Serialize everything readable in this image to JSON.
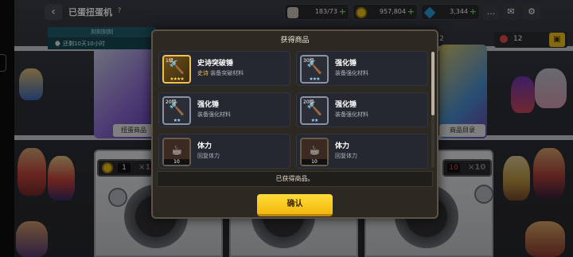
{
  "header": {
    "title": "已蛋扭蛋机",
    "back_glyph": "‹",
    "help_glyph": "?"
  },
  "event": {
    "tag": "刻刻刻刻",
    "time_left": "⌚ 还剩10天10小时"
  },
  "resources": [
    {
      "name": "ticket",
      "value": "183/73",
      "icon": "ticket-icon",
      "color": "#c7c2b3"
    },
    {
      "name": "gold",
      "value": "957,804",
      "icon": "gold-coin-icon",
      "color": "#f0c419"
    },
    {
      "name": "gem",
      "value": "3,344",
      "icon": "gem-icon",
      "color": "#2c9ad8"
    }
  ],
  "top_icons": [
    "chat-icon",
    "mail-icon",
    "settings-icon"
  ],
  "side_panel": {
    "left_num": "2",
    "count": "12"
  },
  "posters": {
    "left_label": "扭蛋商品",
    "right_label": "商品目录"
  },
  "machines": {
    "left_counter": "1",
    "left_multiplier": "×1",
    "right_counter": "10",
    "right_multiplier": "×10"
  },
  "modal": {
    "title": "获得商品",
    "items": [
      {
        "level": "1级",
        "name": "史诗突破锤",
        "desc_tier": "史诗",
        "desc": "装备突破材料",
        "stars": "★★★★",
        "star_color": "gold",
        "glyph": "🔨",
        "frame": "gold"
      },
      {
        "level": "30级",
        "name": "强化锤",
        "desc_tier": "",
        "desc": "装备强化材料",
        "stars": "★★★",
        "star_color": "blue",
        "glyph": "🔨",
        "frame": "blue"
      },
      {
        "level": "20级",
        "name": "强化锤",
        "desc_tier": "",
        "desc": "装备强化材料",
        "stars": "★★",
        "star_color": "blue",
        "glyph": "🔨",
        "frame": "blue"
      },
      {
        "level": "20级",
        "name": "强化锤",
        "desc_tier": "",
        "desc": "装备强化材料",
        "stars": "★★",
        "star_color": "blue",
        "glyph": "🔨",
        "frame": "blue"
      },
      {
        "level": "",
        "name": "体力",
        "desc_tier": "",
        "desc": "回复体力",
        "stars": "",
        "star_color": "",
        "glyph": "☕",
        "frame": "dark",
        "qty": "10"
      },
      {
        "level": "",
        "name": "体力",
        "desc_tier": "",
        "desc": "回复体力",
        "stars": "",
        "star_color": "",
        "glyph": "☕",
        "frame": "dark",
        "qty": "10"
      }
    ],
    "notice": "已获得商品。",
    "confirm_label": "确认"
  }
}
